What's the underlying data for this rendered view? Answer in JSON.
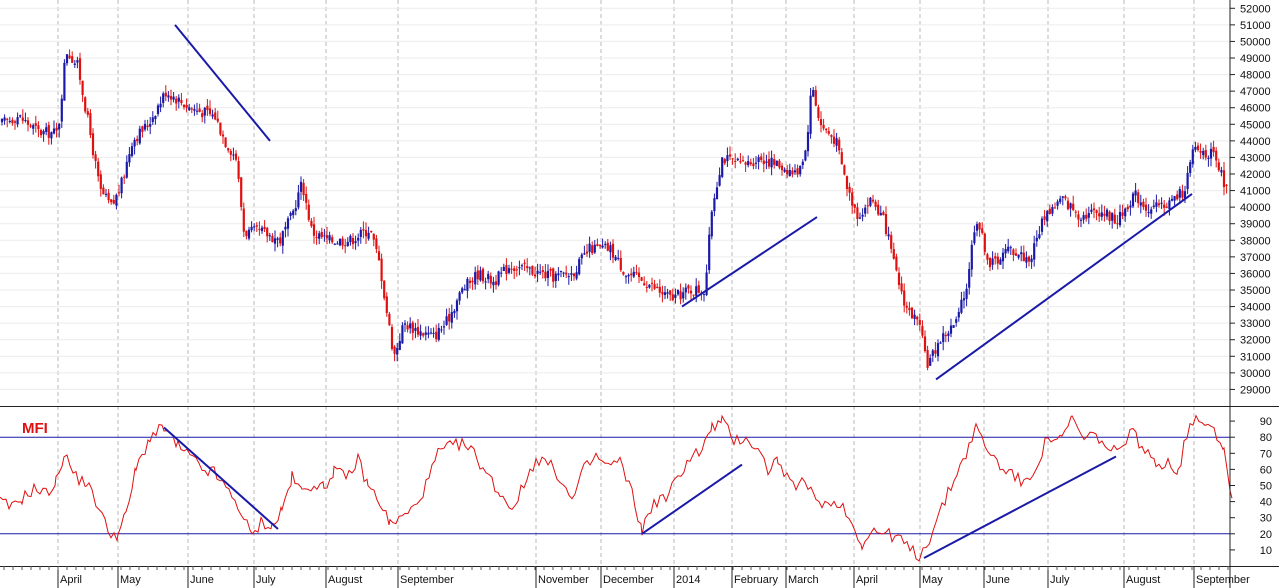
{
  "chart_data": [
    {
      "type": "candlestick",
      "title": "",
      "xlabel": "",
      "ylabel": "",
      "ylim": [
        28000,
        52500
      ],
      "yticks": [
        29000,
        30000,
        31000,
        32000,
        33000,
        34000,
        35000,
        36000,
        37000,
        38000,
        39000,
        40000,
        41000,
        42000,
        43000,
        44000,
        45000,
        46000,
        47000,
        48000,
        49000,
        50000,
        51000,
        52000
      ],
      "grid": true,
      "colors": {
        "up": "#1a1aa8",
        "down": "#e01010",
        "trendline": "#1a1aa8"
      },
      "x_axis_labels": [
        "April",
        "May",
        "June",
        "July",
        "August",
        "September",
        "November",
        "December",
        "2014",
        "February",
        "March",
        "April",
        "May",
        "June",
        "July",
        "August",
        "September"
      ],
      "price_path": [
        [
          0,
          45000
        ],
        [
          18,
          45500
        ],
        [
          40,
          44500
        ],
        [
          58,
          44500
        ],
        [
          66,
          49500
        ],
        [
          78,
          48500
        ],
        [
          90,
          44500
        ],
        [
          100,
          41000
        ],
        [
          112,
          40000
        ],
        [
          122,
          41500
        ],
        [
          132,
          44000
        ],
        [
          148,
          45000
        ],
        [
          166,
          47000
        ],
        [
          190,
          46000
        ],
        [
          215,
          45500
        ],
        [
          225,
          44000
        ],
        [
          236,
          43000
        ],
        [
          244,
          38500
        ],
        [
          262,
          38500
        ],
        [
          280,
          38000
        ],
        [
          292,
          39500
        ],
        [
          302,
          41500
        ],
        [
          312,
          38500
        ],
        [
          328,
          38000
        ],
        [
          350,
          38000
        ],
        [
          370,
          38700
        ],
        [
          380,
          36500
        ],
        [
          386,
          34000
        ],
        [
          394,
          31000
        ],
        [
          404,
          33000
        ],
        [
          420,
          32500
        ],
        [
          434,
          32200
        ],
        [
          446,
          33000
        ],
        [
          462,
          35000
        ],
        [
          478,
          36000
        ],
        [
          494,
          35500
        ],
        [
          510,
          36500
        ],
        [
          530,
          36200
        ],
        [
          552,
          35800
        ],
        [
          572,
          36000
        ],
        [
          590,
          37500
        ],
        [
          610,
          37500
        ],
        [
          626,
          36000
        ],
        [
          646,
          35500
        ],
        [
          662,
          34800
        ],
        [
          672,
          34500
        ],
        [
          690,
          35000
        ],
        [
          705,
          35000
        ],
        [
          712,
          40000
        ],
        [
          722,
          43000
        ],
        [
          742,
          42500
        ],
        [
          760,
          43000
        ],
        [
          780,
          42500
        ],
        [
          796,
          42000
        ],
        [
          806,
          43500
        ],
        [
          812,
          47500
        ],
        [
          820,
          45000
        ],
        [
          836,
          44000
        ],
        [
          848,
          41000
        ],
        [
          858,
          39500
        ],
        [
          872,
          40500
        ],
        [
          885,
          39000
        ],
        [
          896,
          36000
        ],
        [
          906,
          34000
        ],
        [
          918,
          33000
        ],
        [
          928,
          30500
        ],
        [
          940,
          32000
        ],
        [
          956,
          33000
        ],
        [
          966,
          35000
        ],
        [
          976,
          39500
        ],
        [
          990,
          36500
        ],
        [
          1010,
          37500
        ],
        [
          1030,
          36800
        ],
        [
          1044,
          39500
        ],
        [
          1062,
          40500
        ],
        [
          1080,
          39500
        ],
        [
          1100,
          39800
        ],
        [
          1118,
          39200
        ],
        [
          1134,
          40800
        ],
        [
          1150,
          39800
        ],
        [
          1170,
          40300
        ],
        [
          1184,
          41000
        ],
        [
          1194,
          43500
        ],
        [
          1212,
          43200
        ],
        [
          1222,
          41800
        ],
        [
          1230,
          40500
        ]
      ],
      "trendlines": [
        {
          "from": [
            175,
            51000
          ],
          "to": [
            270,
            44000
          ]
        },
        {
          "from": [
            682,
            34000
          ],
          "to": [
            817,
            39400
          ]
        },
        {
          "from": [
            936,
            29600
          ],
          "to": [
            1192,
            40800
          ]
        }
      ]
    },
    {
      "type": "line",
      "title": "MFI",
      "ylabel": "",
      "ylim": [
        0,
        100
      ],
      "yticks": [
        10,
        20,
        30,
        40,
        50,
        60,
        70,
        80,
        90
      ],
      "reference_lines": [
        20,
        80
      ],
      "colors": {
        "line": "#e01010",
        "reference": "#1a1aa8",
        "trendline": "#1a1aa8"
      },
      "series": [
        {
          "name": "",
          "points": [
            [
              0,
              40
            ],
            [
              12,
              36
            ],
            [
              22,
              42
            ],
            [
              34,
              48
            ],
            [
              46,
              45
            ],
            [
              56,
              52
            ],
            [
              64,
              70
            ],
            [
              76,
              55
            ],
            [
              86,
              52
            ],
            [
              96,
              40
            ],
            [
              108,
              22
            ],
            [
              118,
              19
            ],
            [
              126,
              32
            ],
            [
              136,
              60
            ],
            [
              150,
              80
            ],
            [
              164,
              86
            ],
            [
              178,
              74
            ],
            [
              190,
              68
            ],
            [
              202,
              60
            ],
            [
              214,
              58
            ],
            [
              226,
              48
            ],
            [
              238,
              38
            ],
            [
              252,
              18
            ],
            [
              262,
              28
            ],
            [
              272,
              24
            ],
            [
              282,
              35
            ],
            [
              292,
              55
            ],
            [
              302,
              46
            ],
            [
              314,
              52
            ],
            [
              324,
              48
            ],
            [
              334,
              60
            ],
            [
              346,
              54
            ],
            [
              358,
              66
            ],
            [
              368,
              50
            ],
            [
              380,
              40
            ],
            [
              390,
              26
            ],
            [
              402,
              30
            ],
            [
              414,
              36
            ],
            [
              426,
              50
            ],
            [
              438,
              70
            ],
            [
              450,
              74
            ],
            [
              462,
              76
            ],
            [
              474,
              70
            ],
            [
              486,
              58
            ],
            [
              500,
              45
            ],
            [
              512,
              36
            ],
            [
              524,
              50
            ],
            [
              536,
              67
            ],
            [
              548,
              64
            ],
            [
              560,
              55
            ],
            [
              572,
              40
            ],
            [
              584,
              60
            ],
            [
              596,
              68
            ],
            [
              608,
              62
            ],
            [
              620,
              65
            ],
            [
              632,
              45
            ],
            [
              642,
              22
            ],
            [
              654,
              40
            ],
            [
              666,
              42
            ],
            [
              678,
              55
            ],
            [
              690,
              68
            ],
            [
              702,
              72
            ],
            [
              712,
              86
            ],
            [
              722,
              90
            ],
            [
              734,
              78
            ],
            [
              746,
              80
            ],
            [
              758,
              72
            ],
            [
              768,
              60
            ],
            [
              778,
              66
            ],
            [
              790,
              50
            ],
            [
              802,
              52
            ],
            [
              816,
              42
            ],
            [
              828,
              38
            ],
            [
              840,
              40
            ],
            [
              852,
              26
            ],
            [
              862,
              14
            ],
            [
              874,
              22
            ],
            [
              886,
              20
            ],
            [
              898,
              18
            ],
            [
              910,
              10
            ],
            [
              920,
              6
            ],
            [
              930,
              18
            ],
            [
              942,
              36
            ],
            [
              954,
              54
            ],
            [
              966,
              70
            ],
            [
              976,
              86
            ],
            [
              988,
              72
            ],
            [
              1000,
              62
            ],
            [
              1012,
              58
            ],
            [
              1024,
              50
            ],
            [
              1036,
              62
            ],
            [
              1048,
              80
            ],
            [
              1062,
              78
            ],
            [
              1072,
              92
            ],
            [
              1084,
              78
            ],
            [
              1096,
              82
            ],
            [
              1108,
              72
            ],
            [
              1120,
              70
            ],
            [
              1130,
              86
            ],
            [
              1142,
              74
            ],
            [
              1156,
              62
            ],
            [
              1168,
              66
            ],
            [
              1178,
              58
            ],
            [
              1190,
              90
            ],
            [
              1202,
              92
            ],
            [
              1214,
              86
            ],
            [
              1224,
              72
            ],
            [
              1232,
              42
            ]
          ]
        }
      ],
      "trendlines": [
        {
          "from": [
            164,
            86
          ],
          "to": [
            278,
            23
          ]
        },
        {
          "from": [
            642,
            20
          ],
          "to": [
            742,
            63
          ]
        },
        {
          "from": [
            924,
            5
          ],
          "to": [
            1116,
            68
          ]
        }
      ]
    }
  ]
}
